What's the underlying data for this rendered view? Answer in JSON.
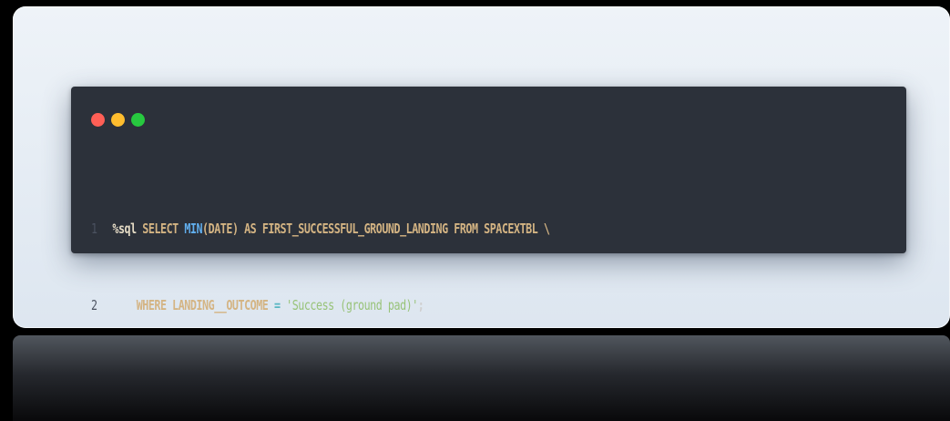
{
  "window": {
    "traffic_lights": [
      {
        "name": "close",
        "color": "#ff5f56"
      },
      {
        "name": "minimize",
        "color": "#ffbd2e"
      },
      {
        "name": "maximize",
        "color": "#27c93f"
      }
    ]
  },
  "code": {
    "lines": [
      {
        "number": "1",
        "tokens": [
          {
            "text": "%sql",
            "kind": "magic"
          },
          {
            "text": " SELECT ",
            "kind": "plain"
          },
          {
            "text": "MIN",
            "kind": "fn"
          },
          {
            "text": "(DATE) AS FIRST_SUCCESSFUL_GROUND_LANDING FROM SPACEXTBL \\",
            "kind": "plain"
          }
        ]
      },
      {
        "number": "2",
        "tokens": [
          {
            "text": "    WHERE LANDING__OUTCOME ",
            "kind": "plain"
          },
          {
            "text": "=",
            "kind": "op"
          },
          {
            "text": " ",
            "kind": "plain"
          },
          {
            "text": "'Success (ground pad)'",
            "kind": "str"
          },
          {
            "text": ";",
            "kind": "punct"
          }
        ]
      }
    ]
  },
  "colors": {
    "editor_background": "#2c313a",
    "card_background": "#e6edf5",
    "page_background": "#000000"
  }
}
